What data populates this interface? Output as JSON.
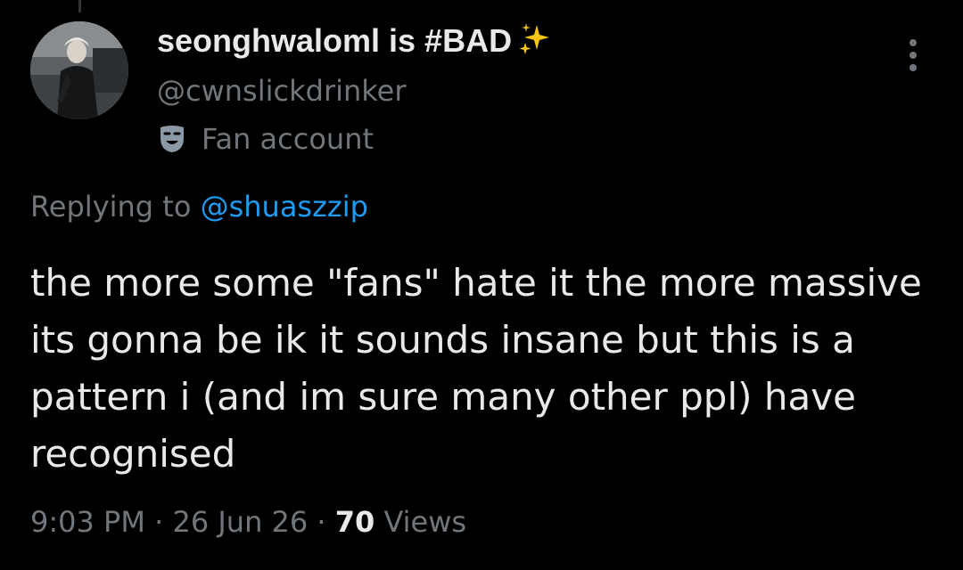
{
  "author": {
    "display_name": "seonghwaloml is #BAD",
    "display_name_emoji": "sparkles-icon",
    "handle": "@cwnslickdrinker",
    "label_icon": "theater-mask-icon",
    "label": "Fan account"
  },
  "reply": {
    "prefix": "Replying to",
    "mention": "@shuaszzip"
  },
  "tweet": {
    "text": "the more some \"fans\" hate it the more massive its gonna be ik it sounds insane but this is a pattern i (and im sure many other ppl) have recognised"
  },
  "meta": {
    "time": "9:03 PM",
    "sep1": "·",
    "date": "26 Jun 26",
    "sep2": "·",
    "views_count": "70",
    "views_label": "Views"
  },
  "colors": {
    "background": "#000000",
    "text_primary": "#e7e9ea",
    "text_secondary": "#71767b",
    "link": "#1d9bf0"
  }
}
